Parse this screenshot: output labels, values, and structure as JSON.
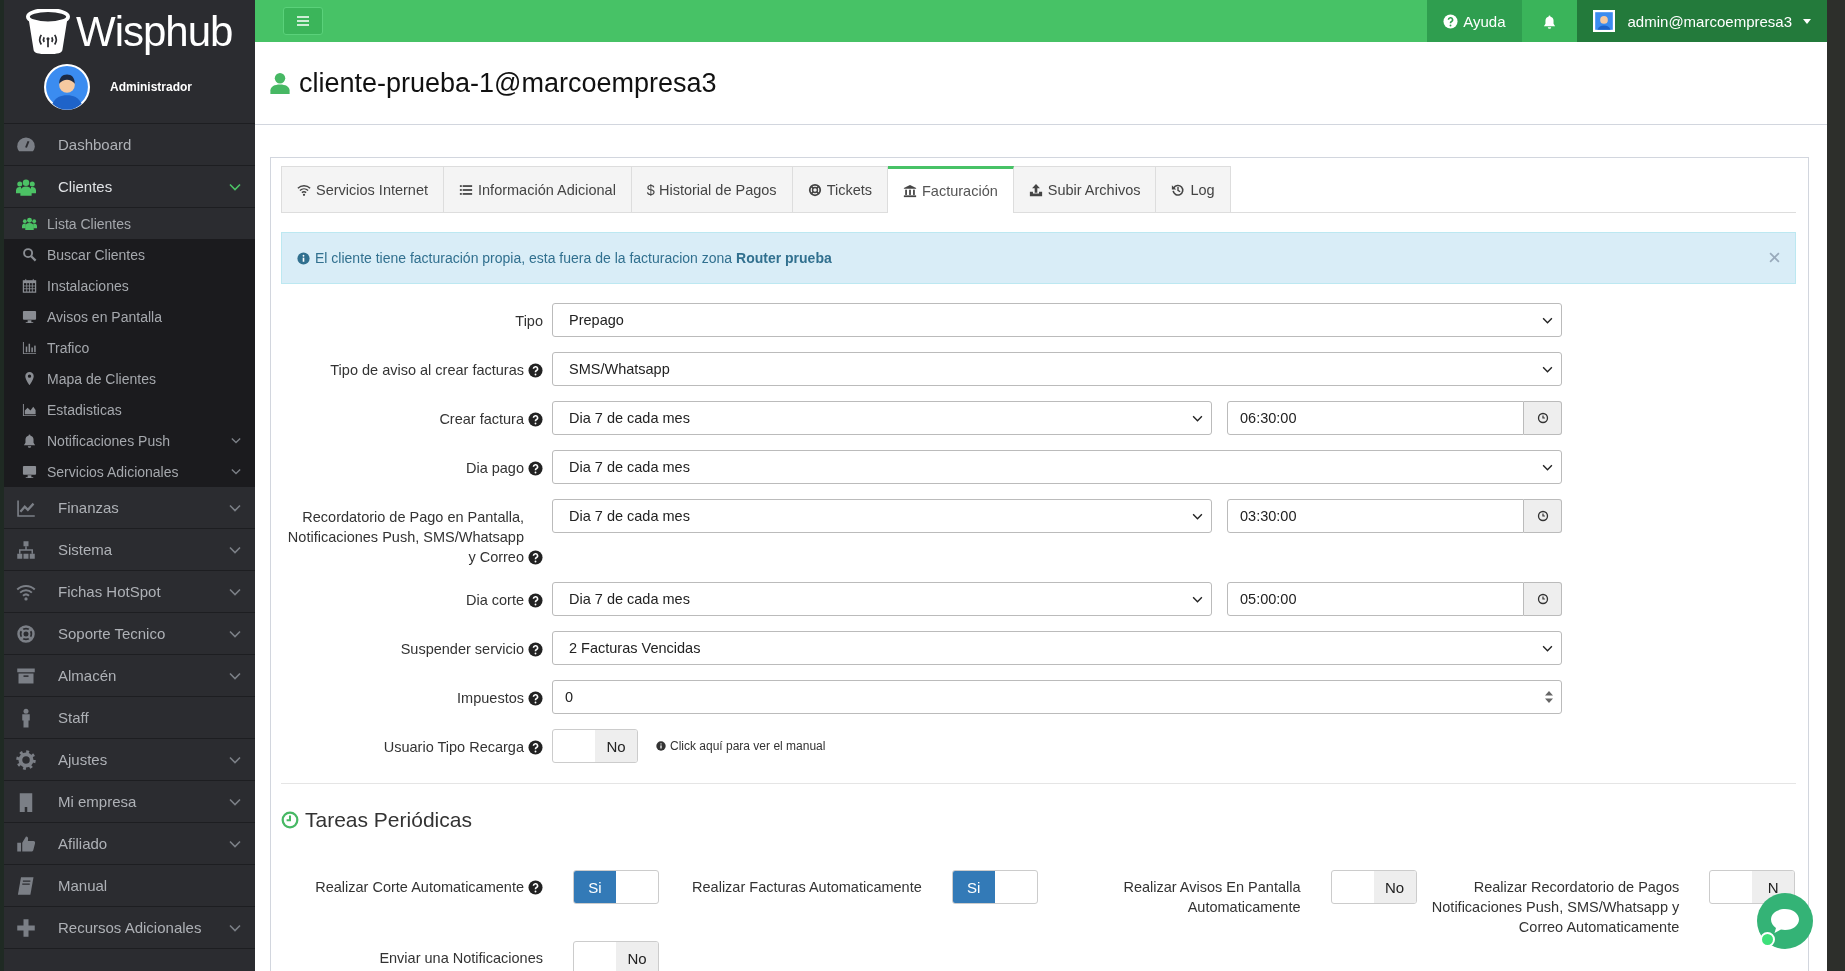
{
  "brand": "Wisphub",
  "user_role": "Administrador",
  "sidebar": [
    {
      "label": "Dashboard",
      "expandable": false,
      "expanded": false
    },
    {
      "label": "Clientes",
      "expandable": true,
      "expanded": true,
      "children": [
        {
          "label": "Lista Clientes",
          "selected": true,
          "expandable": false
        },
        {
          "label": "Buscar Clientes",
          "selected": false,
          "expandable": false
        },
        {
          "label": "Instalaciones",
          "selected": false,
          "expandable": false
        },
        {
          "label": "Avisos en Pantalla",
          "selected": false,
          "expandable": false
        },
        {
          "label": "Trafico",
          "selected": false,
          "expandable": false
        },
        {
          "label": "Mapa de Clientes",
          "selected": false,
          "expandable": false
        },
        {
          "label": "Estadisticas",
          "selected": false,
          "expandable": false
        },
        {
          "label": "Notificaciones Push",
          "selected": false,
          "expandable": true
        },
        {
          "label": "Servicios Adicionales",
          "selected": false,
          "expandable": true
        }
      ]
    },
    {
      "label": "Finanzas",
      "expandable": true,
      "expanded": false
    },
    {
      "label": "Sistema",
      "expandable": true,
      "expanded": false
    },
    {
      "label": "Fichas HotSpot",
      "expandable": true,
      "expanded": false
    },
    {
      "label": "Soporte Tecnico",
      "expandable": true,
      "expanded": false
    },
    {
      "label": "Almacén",
      "expandable": true,
      "expanded": false
    },
    {
      "label": "Staff",
      "expandable": false,
      "expanded": false
    },
    {
      "label": "Ajustes",
      "expandable": true,
      "expanded": false
    },
    {
      "label": "Mi empresa",
      "expandable": true,
      "expanded": false
    },
    {
      "label": "Afiliado",
      "expandable": true,
      "expanded": false
    },
    {
      "label": "Manual",
      "expandable": false,
      "expanded": false
    },
    {
      "label": "Recursos Adicionales",
      "expandable": true,
      "expanded": false
    }
  ],
  "topbar": {
    "help": "Ayuda",
    "user": "admin@marcoempresa3"
  },
  "title": "cliente-prueba-1@marcoempresa3",
  "tabs": [
    {
      "label": "Servicios Internet",
      "selected": false
    },
    {
      "label": "Información Adicional",
      "selected": false
    },
    {
      "label": "$ Historial de Pagos",
      "selected": false
    },
    {
      "label": "Tickets",
      "selected": false
    },
    {
      "label": "Facturación",
      "selected": true
    },
    {
      "label": "Subir Archivos",
      "selected": false
    },
    {
      "label": "Log",
      "selected": false
    }
  ],
  "alert": "El cliente tiene facturación propia, esta fuera de la facturacion zona **Router prueba**",
  "form": [
    {
      "kind": "select",
      "label": "Tipo",
      "help": false,
      "value": "Prepago"
    },
    {
      "kind": "select",
      "label": "Tipo de aviso al crear facturas",
      "help": true,
      "value": "SMS/Whatsapp"
    },
    {
      "kind": "select_time",
      "label": "Crear factura",
      "help": true,
      "value": "Dia 7 de cada mes",
      "time": "06:30:00"
    },
    {
      "kind": "select",
      "label": "Dia pago",
      "help": true,
      "value": "Dia 7 de cada mes"
    },
    {
      "kind": "select_time",
      "label": "Recordatorio de Pago en Pantalla, Notificaciones Push, SMS/Whatsapp y Correo",
      "help": true,
      "value": "Dia 7 de cada mes",
      "time": "03:30:00"
    },
    {
      "kind": "select_time",
      "label": "Dia corte",
      "help": true,
      "value": "Dia 7 de cada mes",
      "time": "05:00:00"
    },
    {
      "kind": "select",
      "label": "Suspender servicio",
      "help": true,
      "value": "2 Facturas Vencidas"
    },
    {
      "kind": "number",
      "label": "Impuestos",
      "help": true,
      "value": "0"
    },
    {
      "kind": "toggle",
      "label": "Usuario Tipo Recarga",
      "help": true,
      "on": false,
      "value": "No",
      "note": "Click aquí para ver el manual"
    }
  ],
  "section_title": "Tareas Periódicas",
  "tasks": [
    {
      "label": "Realizar Corte Automaticamente",
      "help": true,
      "on": true,
      "value": "Si"
    },
    {
      "label": "Realizar Facturas Automaticamente",
      "help": false,
      "on": true,
      "value": "Si"
    },
    {
      "label": "Realizar Avisos En Pantalla Automaticamente",
      "help": false,
      "on": false,
      "value": "No"
    },
    {
      "label": "Realizar Recordatorio de Pagos Notificaciones Push, SMS/Whatsapp y Correo Automaticamente",
      "help": false,
      "on": false,
      "value": "N"
    },
    {
      "label": "Enviar una Notificaciones",
      "help": false,
      "on": false,
      "value": "No"
    }
  ]
}
